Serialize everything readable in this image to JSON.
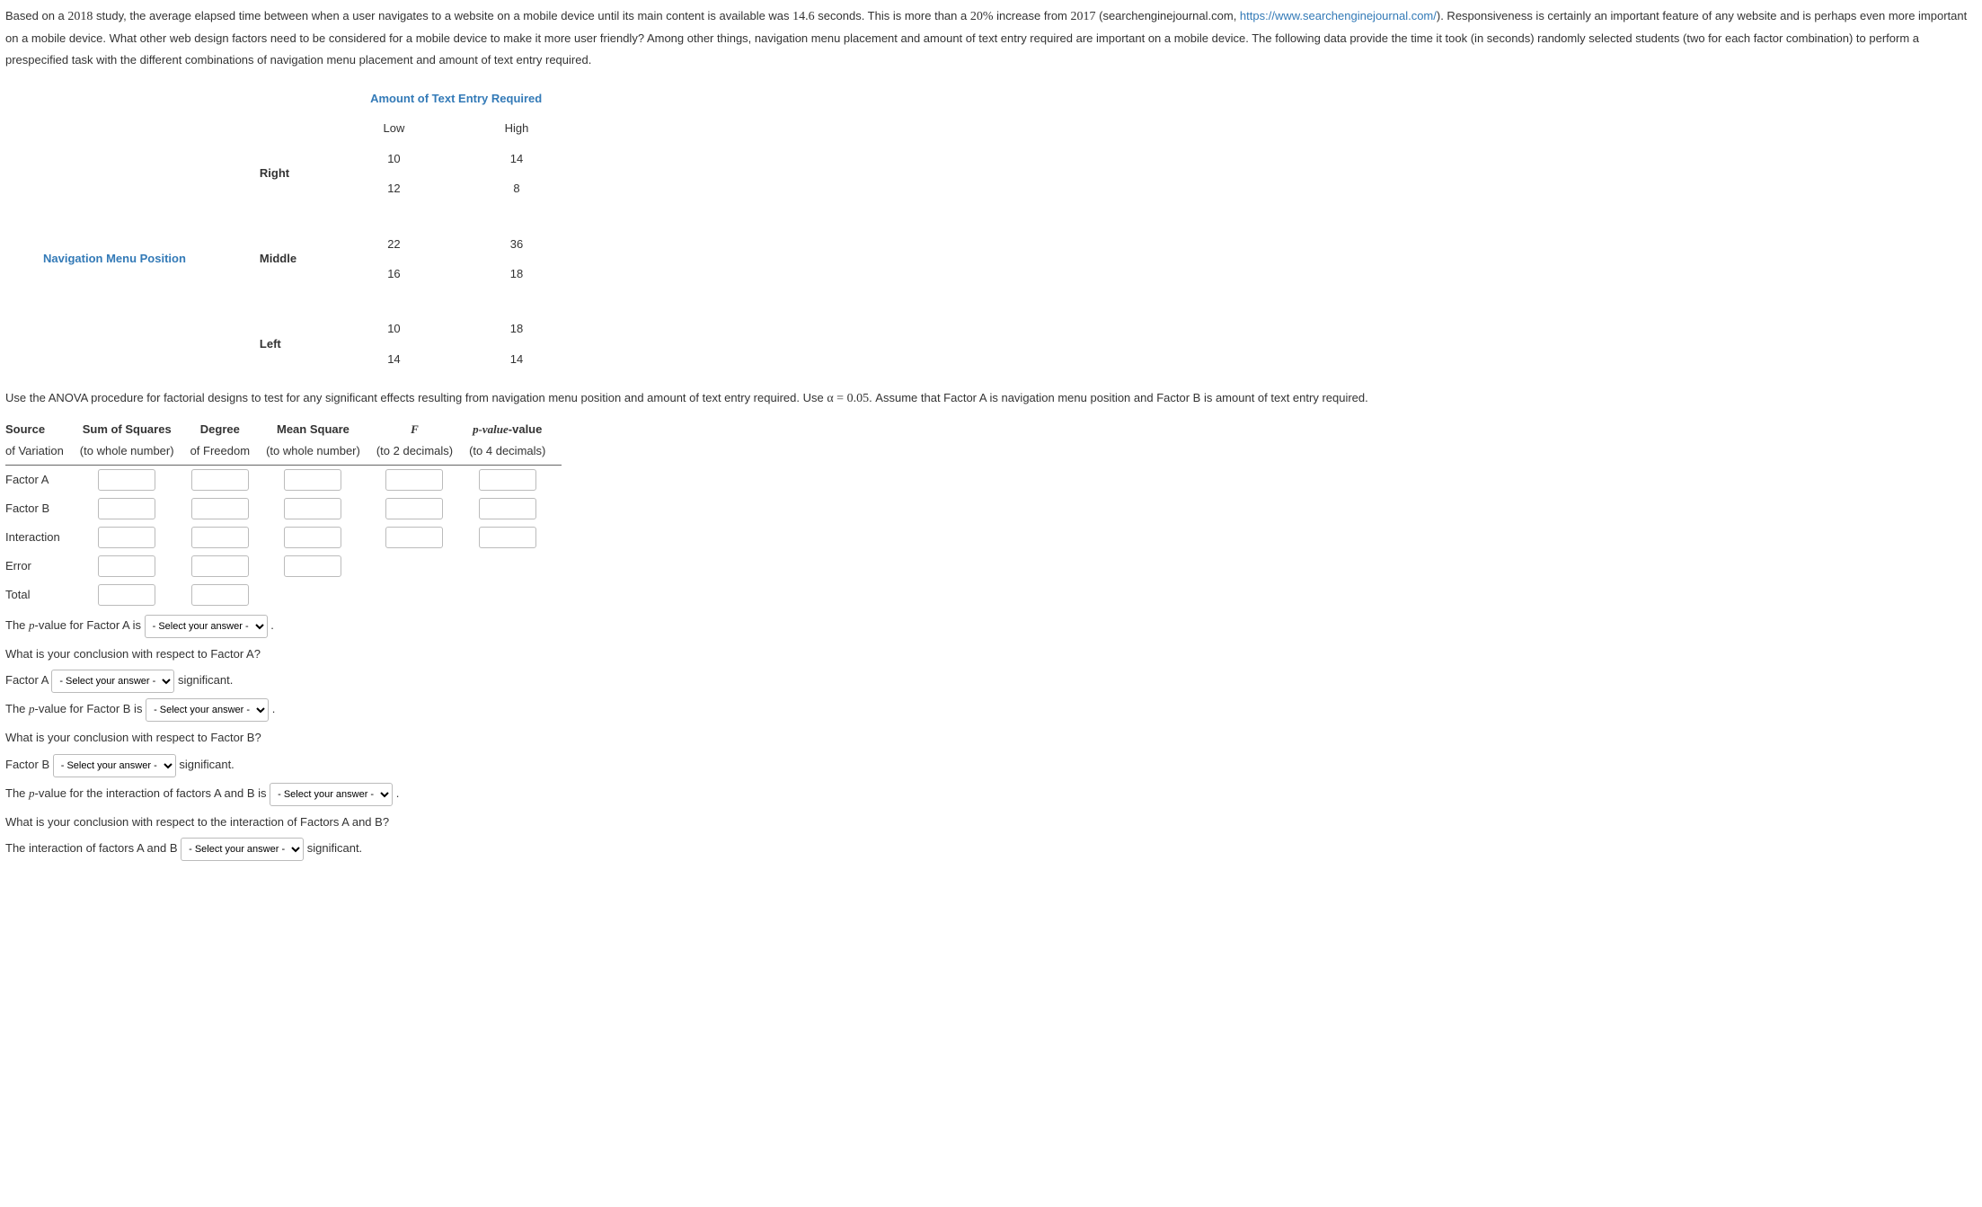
{
  "intro": {
    "text1_a": "Based on a ",
    "year1": "2018",
    "text1_b": " study, the average elapsed time between when a user navigates to a website on a mobile device until its main content is available was ",
    "secs": "14.6",
    "text1_c": " seconds. This is more than a ",
    "pct": "20%",
    "text1_d": " increase from ",
    "year2": "2017",
    "text2_a": " (searchenginejournal.com, ",
    "link": "https://www.searchenginejournal.com/",
    "text2_b": "). Responsiveness is certainly an important feature of any website and is perhaps even more important on a mobile device. What other web design factors need to be considered for a mobile device to make it more user friendly? Among other things, navigation menu placement and amount of text entry required are important on a mobile device. The following data provide the time it took (in seconds) randomly selected students (two for each factor combination) to perform a prespecified task with the different combinations of navigation menu placement and amount of text entry required."
  },
  "data_table": {
    "col_header": "Amount of Text Entry Required",
    "row_header": "Navigation Menu Position",
    "cols": {
      "low": "Low",
      "high": "High"
    },
    "rows": {
      "right": {
        "label": "Right",
        "low": [
          "10",
          "12"
        ],
        "high": [
          "14",
          "8"
        ]
      },
      "middle": {
        "label": "Middle",
        "low": [
          "22",
          "16"
        ],
        "high": [
          "36",
          "18"
        ]
      },
      "left": {
        "label": "Left",
        "low": [
          "10",
          "14"
        ],
        "high": [
          "18",
          "14"
        ]
      }
    }
  },
  "anova_intro": {
    "a": "Use the ANOVA procedure for factorial designs to test for any significant effects resulting from navigation menu position and amount of text entry required. Use ",
    "alpha": "α = 0.05",
    "b": ". Assume that Factor A is navigation menu position and Factor B is amount of text entry required."
  },
  "anova": {
    "headers": {
      "source1": "Source",
      "source2": "of Variation",
      "ss1": "Sum of Squares",
      "ss2": "(to whole number)",
      "df1": "Degree",
      "df2": "of Freedom",
      "ms1": "Mean Square",
      "ms2": "(to whole number)",
      "f1": "F",
      "f2": "(to 2 decimals)",
      "p1": "p-value",
      "p2": "(to 4 decimals)"
    },
    "rows": {
      "factorA": "Factor A",
      "factorB": "Factor B",
      "interaction": "Interaction",
      "error": "Error",
      "total": "Total"
    }
  },
  "questions": {
    "select_placeholder": "- Select your answer -",
    "q1_a": "The ",
    "pval": "p",
    "q1_b": "-value for Factor A is ",
    "q1_c": ".",
    "q2": "What is your conclusion with respect to Factor A?",
    "q3_a": "Factor A ",
    "q3_b": " significant.",
    "q4_a": "The ",
    "q4_b": "-value for Factor B is ",
    "q4_c": ".",
    "q5": "What is your conclusion with respect to Factor B?",
    "q6_a": "Factor B ",
    "q6_b": " significant.",
    "q7_a": "The ",
    "q7_b": "-value for the interaction of factors A and B is ",
    "q7_c": ".",
    "q8": "What is your conclusion with respect to the interaction of Factors A and B?",
    "q9_a": "The interaction of factors A and B ",
    "q9_b": " significant."
  }
}
